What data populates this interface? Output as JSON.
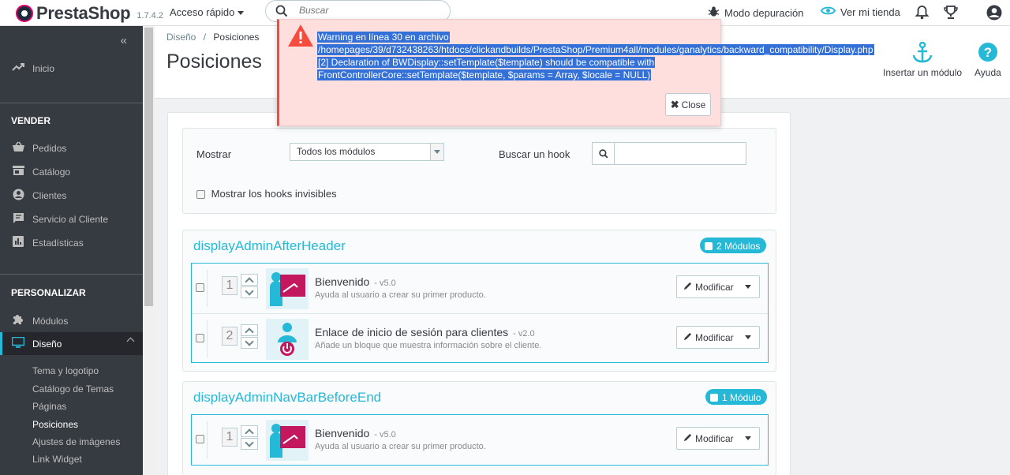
{
  "topbar": {
    "brand": "PrestaShop",
    "version": "1.7.4.2",
    "quick_access": "Acceso rápido",
    "search_placeholder": "Buscar",
    "debug_mode": "Modo depuración",
    "view_store": "Ver mi tienda"
  },
  "sidebar": {
    "home": "Inicio",
    "sell_section": "VENDER",
    "sell_items": [
      "Pedidos",
      "Catálogo",
      "Clientes",
      "Servicio al Cliente",
      "Estadísticas"
    ],
    "customize_section": "PERSONALIZAR",
    "modules": "Módulos",
    "design": "Diseño",
    "design_sub": [
      "Tema y logotipo",
      "Catálogo de Temas",
      "Páginas",
      "Posiciones",
      "Ajustes de imágenes",
      "Link Widget"
    ]
  },
  "header": {
    "breadcrumb_parent": "Diseño",
    "breadcrumb_sep": "/",
    "breadcrumb_current": "Posiciones",
    "title": "Posiciones",
    "insert_module": "Insertar un módulo",
    "help": "Ayuda"
  },
  "filter": {
    "show_label": "Mostrar",
    "show_value": "Todos los módulos",
    "search_hook_label": "Buscar un hook",
    "show_invisible_label": "Mostrar los hooks invisibles"
  },
  "hooks": [
    {
      "name": "displayAdminAfterHeader",
      "badge": "2 Módulos",
      "modules": [
        {
          "position": "1",
          "name": "Bienvenido",
          "version": "- v5.0",
          "description": "Ayuda al usuario a crear su primer producto.",
          "button": "Modificar"
        },
        {
          "position": "2",
          "name": "Enlace de inicio de sesión para clientes",
          "version": "- v2.0",
          "description": "Añade un bloque que muestra información sobre el cliente.",
          "button": "Modificar"
        }
      ]
    },
    {
      "name": "displayAdminNavBarBeforeEnd",
      "badge": "1 Módulo",
      "modules": [
        {
          "position": "1",
          "name": "Bienvenido",
          "version": "- v5.0",
          "description": "Ayuda al usuario a crear su primer producto.",
          "button": "Modificar"
        }
      ]
    }
  ],
  "warning": {
    "line1": "Warning en línea 30 en archivo",
    "line2": "/homepages/39/d732438263/htdocs/clickandbuilds/PrestaShop/Premium4all/modules/ganalytics/backward_compatibility/Display.php",
    "line3": "[2] Declaration of BWDisplay::setTemplate($template) should be compatible with",
    "line4": "FrontControllerCore::setTemplate($template, $params = Array, $locale = NULL)",
    "close": "Close"
  },
  "colors": {
    "accent": "#25b9d7",
    "sidebar_bg": "#363a41",
    "warning_bg": "#ffdede",
    "selection": "#3370d8",
    "brand_pink": "#df0067"
  }
}
